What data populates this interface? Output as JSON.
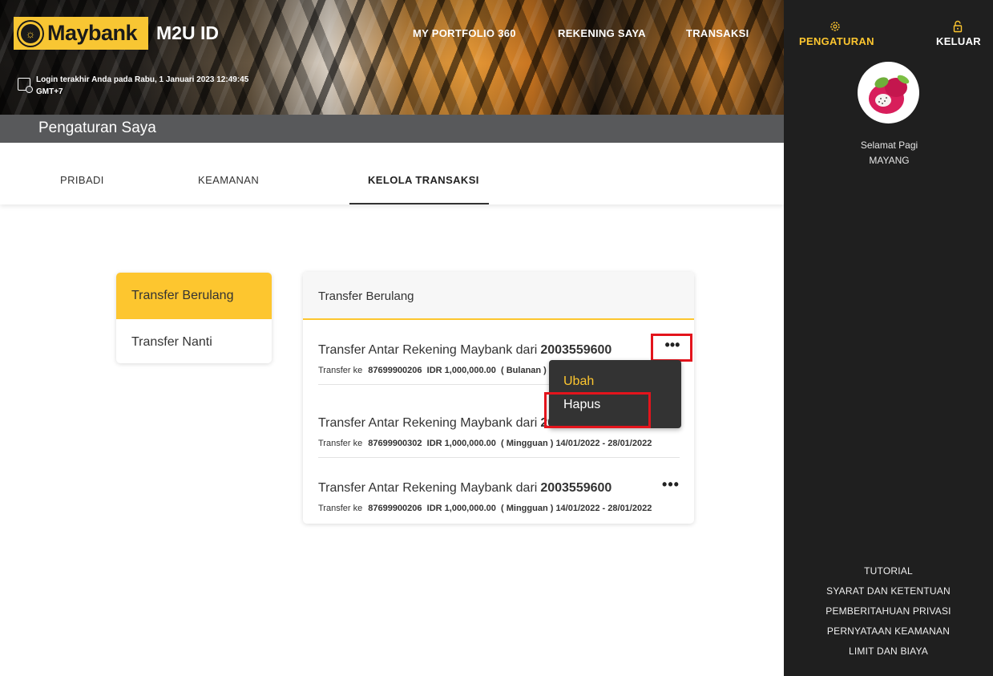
{
  "header": {
    "logo_text": "Maybank",
    "brand_sub": "M2U ID",
    "login_info": "Login terakhir Anda pada Rabu, 1 Januari 2023 12:49:45 GMT+7",
    "nav": {
      "portfolio": "MY PORTFOLIO 360",
      "rekening": "REKENING SAYA",
      "transaksi": "TRANSAKSI"
    }
  },
  "page_title": "Pengaturan Saya",
  "tabs": {
    "pribadi": "PRIBADI",
    "keamanan": "KEAMANAN",
    "kelola": "KELOLA TRANSAKSI"
  },
  "side_menu": {
    "berulang": "Transfer Berulang",
    "nanti": "Transfer Nanti"
  },
  "list": {
    "title": "Transfer Berulang",
    "label_to": "Transfer ke",
    "rows": [
      {
        "title": "Transfer Antar Rekening Maybank dari",
        "account": "2003559600",
        "to_account": "87699900206",
        "amount": "IDR 1,000,000.00",
        "schedule": "( Bulanan )"
      },
      {
        "title": "Transfer Antar Rekening Maybank dari",
        "account": "20",
        "to_account": "87699900302",
        "amount": "IDR 1,000,000.00",
        "schedule": "( Mingguan ) 14/01/2022 - 28/01/2022"
      },
      {
        "title": "Transfer Antar Rekening Maybank dari",
        "account": "2003559600",
        "to_account": "87699900206",
        "amount": "IDR 1,000,000.00",
        "schedule": "( Mingguan ) 14/01/2022 - 28/01/2022"
      }
    ],
    "more_glyph": "•••"
  },
  "dropdown": {
    "ubah": "Ubah",
    "hapus": "Hapus"
  },
  "sidebar": {
    "settings": "PENGATURAN",
    "logout": "KELUAR",
    "greeting_line1": "Selamat Pagi",
    "greeting_line2": "MAYANG",
    "links": {
      "tutorial": "TUTORIAL",
      "syarat": "SYARAT DAN KETENTUAN",
      "privasi": "PEMBERITAHUAN PRIVASI",
      "keamanan": "PERNYATAAN KEAMANAN",
      "limit": "LIMIT DAN BIAYA"
    }
  },
  "colors": {
    "brand_yellow": "#fdc62f",
    "sidebar_bg": "#1f1f1f",
    "highlight_red": "#e3141c",
    "title_bar": "#58595b"
  },
  "icons": [
    "maybank-tiger-emblem",
    "login-history-icon",
    "gear-icon",
    "padlock-icon",
    "avatar-dragonfruit"
  ]
}
